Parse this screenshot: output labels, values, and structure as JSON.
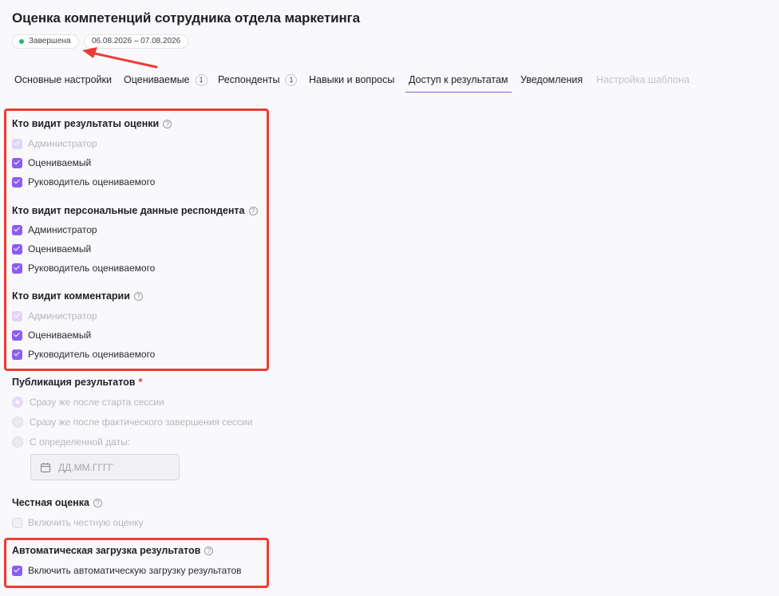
{
  "page": {
    "title": "Оценка компетенций сотрудника отдела маркетинга",
    "status_badge": "Завершена",
    "date_range": "06.08.2026 – 07.08.2026"
  },
  "tabs": [
    {
      "label": "Основные настройки",
      "count": null,
      "state": "normal"
    },
    {
      "label": "Оцениваемые",
      "count": "1",
      "state": "normal"
    },
    {
      "label": "Респонденты",
      "count": "1",
      "state": "normal"
    },
    {
      "label": "Навыки и вопросы",
      "count": null,
      "state": "normal"
    },
    {
      "label": "Доступ к результатам",
      "count": null,
      "state": "active"
    },
    {
      "label": "Уведомления",
      "count": null,
      "state": "normal"
    },
    {
      "label": "Настройка шаблона",
      "count": null,
      "state": "disabled"
    }
  ],
  "results_visibility": {
    "title": "Кто видит результаты оценки",
    "options": [
      {
        "label": "Администратор",
        "checked": true,
        "disabled": true
      },
      {
        "label": "Оцениваемый",
        "checked": true,
        "disabled": false
      },
      {
        "label": "Руководитель оцениваемого",
        "checked": true,
        "disabled": false
      }
    ]
  },
  "personal_data_visibility": {
    "title": "Кто видит персональные данные респондента",
    "options": [
      {
        "label": "Администратор",
        "checked": true,
        "disabled": false
      },
      {
        "label": "Оцениваемый",
        "checked": true,
        "disabled": false
      },
      {
        "label": "Руководитель оцениваемого",
        "checked": true,
        "disabled": false
      }
    ]
  },
  "comments_visibility": {
    "title": "Кто видит комментарии",
    "options": [
      {
        "label": "Администратор",
        "checked": true,
        "disabled": true
      },
      {
        "label": "Оцениваемый",
        "checked": true,
        "disabled": false
      },
      {
        "label": "Руководитель оцениваемого",
        "checked": true,
        "disabled": false
      }
    ]
  },
  "publication": {
    "title": "Публикация результатов",
    "required_mark": "*",
    "options": [
      {
        "label": "Сразу же после старта сессии",
        "selected": true
      },
      {
        "label": "Сразу же после фактического завершения сессии",
        "selected": false
      },
      {
        "label": "С определенной даты:",
        "selected": false
      }
    ],
    "date_placeholder": "ДД.ММ.ГГГГ"
  },
  "honest_rating": {
    "title": "Честная оценка",
    "checkbox_label": "Включить честную оценку",
    "checked": false
  },
  "auto_upload": {
    "title": "Автоматическая загрузка результатов",
    "checkbox_label": "Включить автоматическую загрузку результатов",
    "checked": true
  },
  "colors": {
    "accent": "#8b5cf6",
    "status_green": "#34b56a",
    "annotation_red": "#ef3b35"
  }
}
